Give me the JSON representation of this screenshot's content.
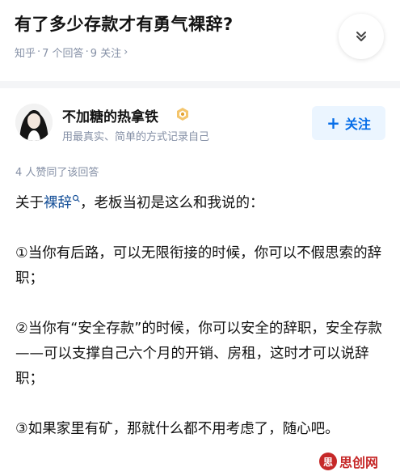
{
  "question": {
    "title": "有了多少存款才有勇气裸辞?",
    "source": "知乎",
    "separator": "·",
    "answers_count": "7 个回答",
    "followers_count": "9 关注",
    "meta_chevron": "›"
  },
  "author": {
    "name": "不加糖的热拿铁",
    "bio": "用最真实、简单的方式记录自己",
    "follow_plus": "+",
    "follow_label": "关注"
  },
  "upvotes_text": "4 人赞同了该回答",
  "answer": {
    "intro_prefix": "关于",
    "intro_keyword": "裸辞",
    "intro_suffix": "，老板当初是这么和我说的：",
    "point1": "①当你有后路，可以无限衔接的时候，你可以不假思索的辞职；",
    "point2": "②当你有“安全存款”的时候，你可以安全的辞职，安全存款——可以支撑自己六个月的开销、房租，这时才可以说辞职；",
    "point3": "③如果家里有矿，那就什么都不用考虑了，随心吧。"
  },
  "watermark": {
    "text": "思创网",
    "logo_glyph": "思"
  },
  "colors": {
    "accent": "#056de8",
    "meta_gray": "#8590a6",
    "link_blue": "#175199",
    "follow_bg": "#ebf5ff"
  },
  "icons": {
    "collapse": "double-chevron-down-icon",
    "badge": "creator-badge-icon",
    "search_keyword": "search-icon"
  }
}
